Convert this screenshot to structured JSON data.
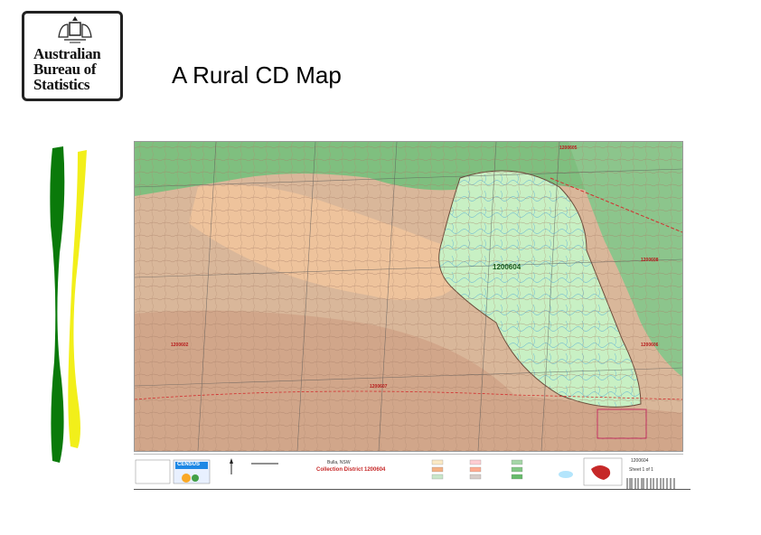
{
  "logo": {
    "lines": [
      "Australian",
      "Bureau of",
      "Statistics"
    ]
  },
  "slide": {
    "title": "A Rural CD Map"
  },
  "map": {
    "main_cd_label": "1200604",
    "neighbour_labels": [
      "1200605",
      "1200607",
      "1200606",
      "1200602",
      "1200608"
    ],
    "legend": {
      "place": "Bulla, NSW",
      "district_title": "Collection District 1200604",
      "census_badge": "CENSUS",
      "cd_code": "1200604",
      "sheet": "Sheet 1 of 1"
    }
  },
  "colors": {
    "stripe_green": "#0a7a0a",
    "stripe_yellow": "#f2ef1a",
    "map_cd_fill": "#c8f0c4",
    "map_terrain": "#d9b79a",
    "map_forest": "#7fbf7f",
    "boundary_red": "#d32f2f"
  }
}
